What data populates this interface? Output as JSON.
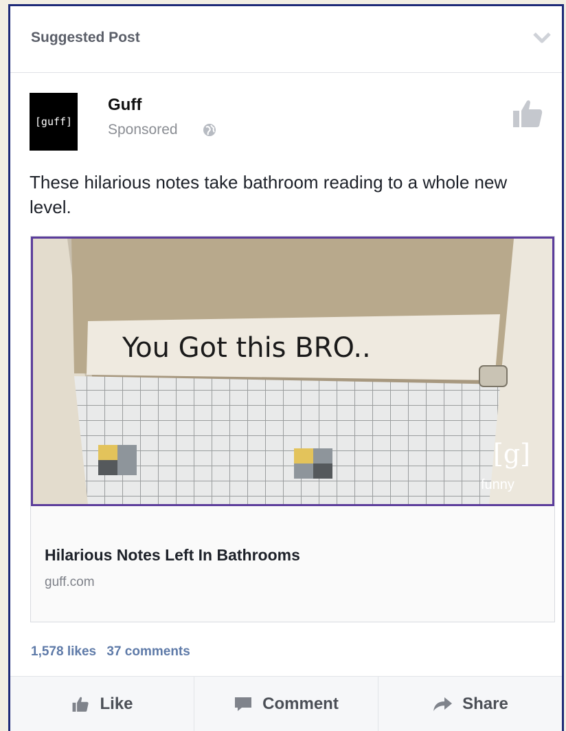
{
  "header": {
    "title": "Suggested Post"
  },
  "post": {
    "page_name": "Guff",
    "logo_text": "[guff]",
    "sponsored_label": "Sponsored",
    "text": "These hilarious notes take bathroom reading to a whole new level.",
    "image_caption_graffiti": "You Got this BRO..",
    "image_watermark_bracket": "[g]",
    "image_watermark_word": "funny",
    "link_title": "Hilarious Notes Left In Bathrooms",
    "link_domain": "guff.com"
  },
  "stats": {
    "likes": "1,578 likes",
    "comments": "37 comments"
  },
  "actions": {
    "like": "Like",
    "comment": "Comment",
    "share": "Share"
  },
  "colors": {
    "accent": "#5b3c9b",
    "border": "#1e2a78",
    "stats": "#5e7aa8"
  },
  "icons": [
    "chevron-down-icon",
    "globe-icon",
    "thumbs-up-icon",
    "comment-icon",
    "share-arrow-icon"
  ]
}
